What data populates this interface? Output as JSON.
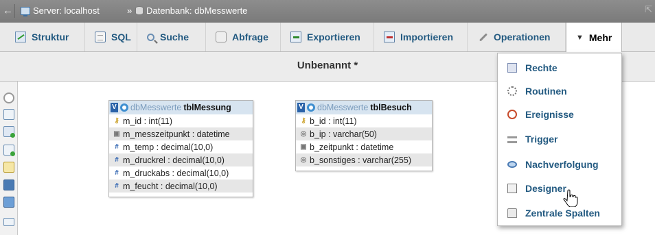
{
  "breadcrumb": {
    "back_glyph": "←",
    "server": "Server: localhost",
    "separator": "»",
    "database": "Datenbank: dbMesswerte",
    "collapse_glyph": "⇱"
  },
  "tabs": [
    {
      "label": "Struktur",
      "icon": "structure-icon"
    },
    {
      "label": "SQL",
      "icon": "sql-icon"
    },
    {
      "label": "Suche",
      "icon": "search-icon"
    },
    {
      "label": "Abfrage",
      "icon": "query-icon"
    },
    {
      "label": "Exportieren",
      "icon": "export-icon"
    },
    {
      "label": "Importieren",
      "icon": "import-icon"
    },
    {
      "label": "Operationen",
      "icon": "wrench-icon"
    },
    {
      "label": "Mehr",
      "icon": "caret-down-icon"
    }
  ],
  "subtitle": "Unbenannt *",
  "tables": [
    {
      "db": "dbMesswerte",
      "name": "tblMessung",
      "check": "V",
      "columns": [
        {
          "text": "m_id : int(11)",
          "icon": "key-icon"
        },
        {
          "text": "m_messzeitpunkt : datetime",
          "icon": "calendar-icon"
        },
        {
          "text": "m_temp : decimal(10,0)",
          "icon": "hash-icon"
        },
        {
          "text": "m_druckrel : decimal(10,0)",
          "icon": "hash-icon"
        },
        {
          "text": "m_druckabs : decimal(10,0)",
          "icon": "hash-icon"
        },
        {
          "text": "m_feucht : decimal(10,0)",
          "icon": "hash-icon"
        }
      ]
    },
    {
      "db": "dbMesswerte",
      "name": "tblBesuch",
      "check": "V",
      "columns": [
        {
          "text": "b_id : int(11)",
          "icon": "key-icon"
        },
        {
          "text": "b_ip : varchar(50)",
          "icon": "string-icon"
        },
        {
          "text": "b_zeitpunkt : datetime",
          "icon": "calendar-icon"
        },
        {
          "text": "b_sonstiges : varchar(255)",
          "icon": "string-icon"
        }
      ]
    }
  ],
  "more_menu": [
    {
      "label": "Rechte",
      "icon": "users-icon"
    },
    {
      "label": "Routinen",
      "icon": "routines-icon"
    },
    {
      "label": "Ereignisse",
      "icon": "clock-icon"
    },
    {
      "label": "Trigger",
      "icon": "trigger-icon"
    },
    {
      "label": "Nachverfolgung",
      "icon": "eye-icon"
    },
    {
      "label": "Designer",
      "icon": "designer-icon"
    },
    {
      "label": "Zentrale Spalten",
      "icon": "central-columns-icon"
    }
  ],
  "colors": {
    "link": "#235a81",
    "breadcrumb_bg": "#858585",
    "table_header": "#d7e4f0"
  }
}
